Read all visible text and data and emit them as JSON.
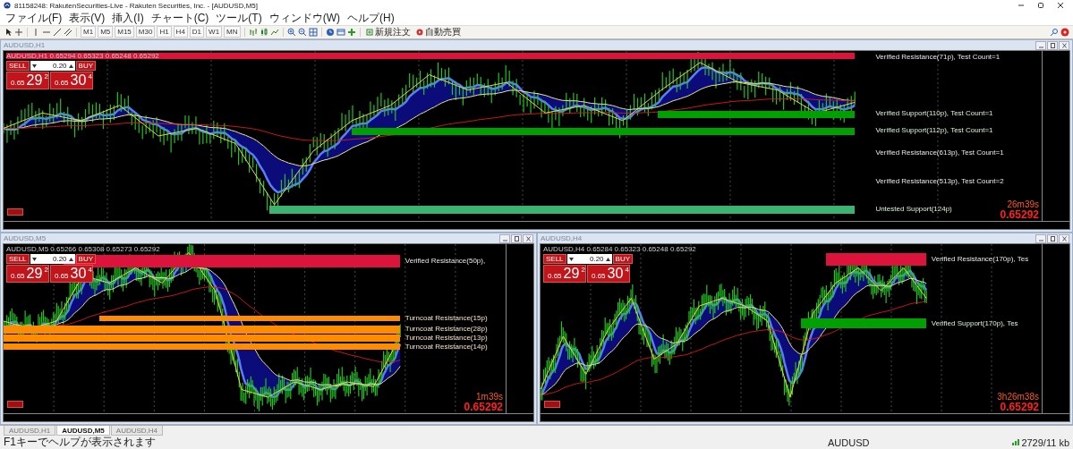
{
  "window": {
    "title": "81158248: RakutenSecurities-Live - Rakuten Securities, Inc. - [AUDUSD,M5]"
  },
  "menu": [
    "ファイル(F)",
    "表示(V)",
    "挿入(I)",
    "チャート(C)",
    "ツール(T)",
    "ウィンドウ(W)",
    "ヘルプ(H)"
  ],
  "toolbar": {
    "timeframes": [
      "M1",
      "M5",
      "M15",
      "M30",
      "H1",
      "H4",
      "D1",
      "W1",
      "MN"
    ],
    "new_order": "新規注文",
    "auto_trading": "自動売買"
  },
  "charts": [
    {
      "title": "AUDUSD,H1",
      "header": "AUDUSD,H1  0.65294 0.65323 0.65248 0.65292",
      "trade_panel": {
        "sell": "SELL",
        "buy": "BUY",
        "lots": "0.20",
        "bid": {
          "prefix": "0.65",
          "big": "29",
          "sup": "2"
        },
        "ask": {
          "prefix": "0.65",
          "big": "30",
          "sup": "4"
        }
      },
      "zones": [
        {
          "kind": "resistance",
          "label": "Verified Resistance(71p), Test Count=1",
          "color": "#dc143c"
        },
        {
          "kind": "support",
          "label": "Verified Support(110p), Test Count=1",
          "color": "#00a000"
        },
        {
          "kind": "support",
          "label": "Verified Support(112p), Test Count=1",
          "color": "#00a000"
        },
        {
          "kind": "resistance",
          "label": "Verified Resistance(613p), Test Count=1"
        },
        {
          "kind": "resistance",
          "label": "Verified Resistance(513p), Test Count=2"
        },
        {
          "kind": "support",
          "label": "Untested Support(124p)",
          "color": "#3cb371"
        }
      ],
      "countdown": "26m39s",
      "price": "0.65292"
    },
    {
      "title": "AUDUSD,M5",
      "header": "AUDUSD,M5  0.65266 0.65308 0.65273 0.65292",
      "trade_panel": {
        "sell": "SELL",
        "buy": "BUY",
        "lots": "0.20",
        "bid": {
          "prefix": "0.65",
          "big": "29",
          "sup": "2"
        },
        "ask": {
          "prefix": "0.65",
          "big": "30",
          "sup": "4"
        }
      },
      "zones": [
        {
          "kind": "resistance",
          "label": "Verified Resistance(50p),",
          "color": "#dc143c"
        },
        {
          "kind": "turncoat",
          "label": "Turncoat Resistance(15p)",
          "color": "#ff8c00"
        },
        {
          "kind": "turncoat",
          "label": "Turncoat Resistance(28p)",
          "color": "#ff8c00"
        },
        {
          "kind": "turncoat",
          "label": "Turncoat Resistance(13p)",
          "color": "#ff8c00"
        },
        {
          "kind": "turncoat",
          "label": "Turncoat Resistance(14p)",
          "color": "#ff8c00"
        }
      ],
      "countdown": "1m39s",
      "price": "0.65292"
    },
    {
      "title": "AUDUSD,H4",
      "header": "AUDUSD,H4  0.65284 0.65323 0.65248 0.65292",
      "trade_panel": {
        "sell": "SELL",
        "buy": "BUY",
        "lots": "0.20",
        "bid": {
          "prefix": "0.65",
          "big": "29",
          "sup": "2"
        },
        "ask": {
          "prefix": "0.65",
          "big": "30",
          "sup": "4"
        }
      },
      "zones": [
        {
          "kind": "resistance",
          "label": "Verified Resistance(170p), Tes",
          "color": "#dc143c"
        },
        {
          "kind": "support",
          "label": "Verified Support(170p), Tes",
          "color": "#00a000"
        }
      ],
      "countdown": "3h26m38s",
      "price": "0.65292"
    }
  ],
  "tabs": [
    {
      "label": "AUDUSD,H1",
      "selected": false
    },
    {
      "label": "AUDUSD,M5",
      "selected": true
    },
    {
      "label": "AUDUSD,H4",
      "selected": false
    }
  ],
  "status_bar": {
    "help": "F1キーでヘルプが表示されます",
    "symbol": "AUDUSD",
    "traffic": "2729/11 kb"
  }
}
